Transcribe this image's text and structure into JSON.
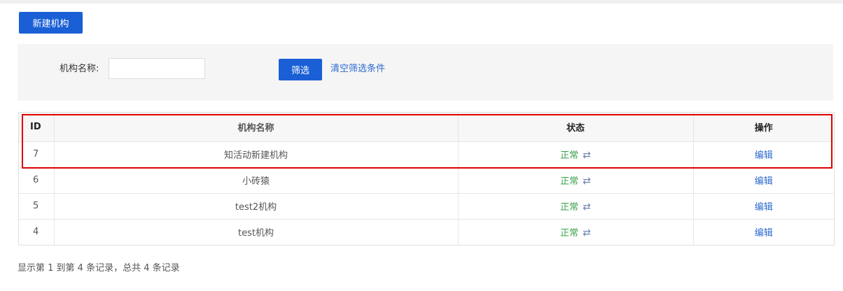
{
  "toolbar": {
    "new_button_label": "新建机构"
  },
  "filter": {
    "name_label": "机构名称:",
    "name_value": "",
    "name_placeholder": "",
    "filter_button_label": "筛选",
    "clear_link_label": "清空筛选条件"
  },
  "table": {
    "headers": {
      "id": "ID",
      "name": "机构名称",
      "status": "状态",
      "operation": "操作"
    },
    "rows": [
      {
        "id": "7",
        "name": "知活动新建机构",
        "status": "正常",
        "toggle_icon": "⇄",
        "action": "编辑"
      },
      {
        "id": "6",
        "name": "小砖猿",
        "status": "正常",
        "toggle_icon": "⇄",
        "action": "编辑"
      },
      {
        "id": "5",
        "name": "test2机构",
        "status": "正常",
        "toggle_icon": "⇄",
        "action": "编辑"
      },
      {
        "id": "4",
        "name": "test机构",
        "status": "正常",
        "toggle_icon": "⇄",
        "action": "编辑"
      }
    ]
  },
  "footer": {
    "summary": "显示第 1 到第 4 条记录，总共 4 条记录"
  },
  "colors": {
    "primary": "#1a5fd6",
    "status_ok": "#3aa14a",
    "link": "#2d6bd0",
    "highlight": "#e00000"
  }
}
